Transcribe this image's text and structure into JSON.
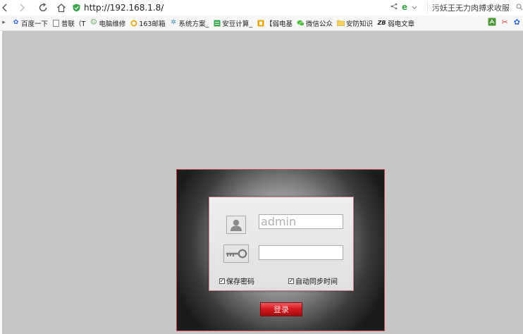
{
  "address_bar": {
    "url": "http://192.168.1.8/"
  },
  "search": {
    "text": "污妖王无力肉搏求收服"
  },
  "bookmarks": {
    "items": [
      {
        "icon": "paw-icon",
        "label": "百度一下"
      },
      {
        "icon": "document-icon",
        "label": "普联（T"
      },
      {
        "icon": "people-icon",
        "label": "电脑维修"
      },
      {
        "icon": "ring-icon",
        "label": "163邮箱"
      },
      {
        "icon": "gear-icon",
        "label": "系统方案_"
      },
      {
        "icon": "grid-icon",
        "label": "安豆计算_"
      },
      {
        "icon": "book-icon",
        "label": "【弱电基"
      },
      {
        "icon": "wechat-icon",
        "label": "微信公众"
      },
      {
        "icon": "folder-icon",
        "label": "安防知识"
      },
      {
        "icon": "zb-icon",
        "label": "弱电文章"
      }
    ]
  },
  "login": {
    "username_value": "admin",
    "password_value": "",
    "remember_label": "保存密码",
    "sync_label": "自动同步时间",
    "login_button": "登录"
  },
  "colors": {
    "page_background": "#c6c6c6",
    "frame_border": "#c8434a",
    "button_red": "#d61a21"
  }
}
